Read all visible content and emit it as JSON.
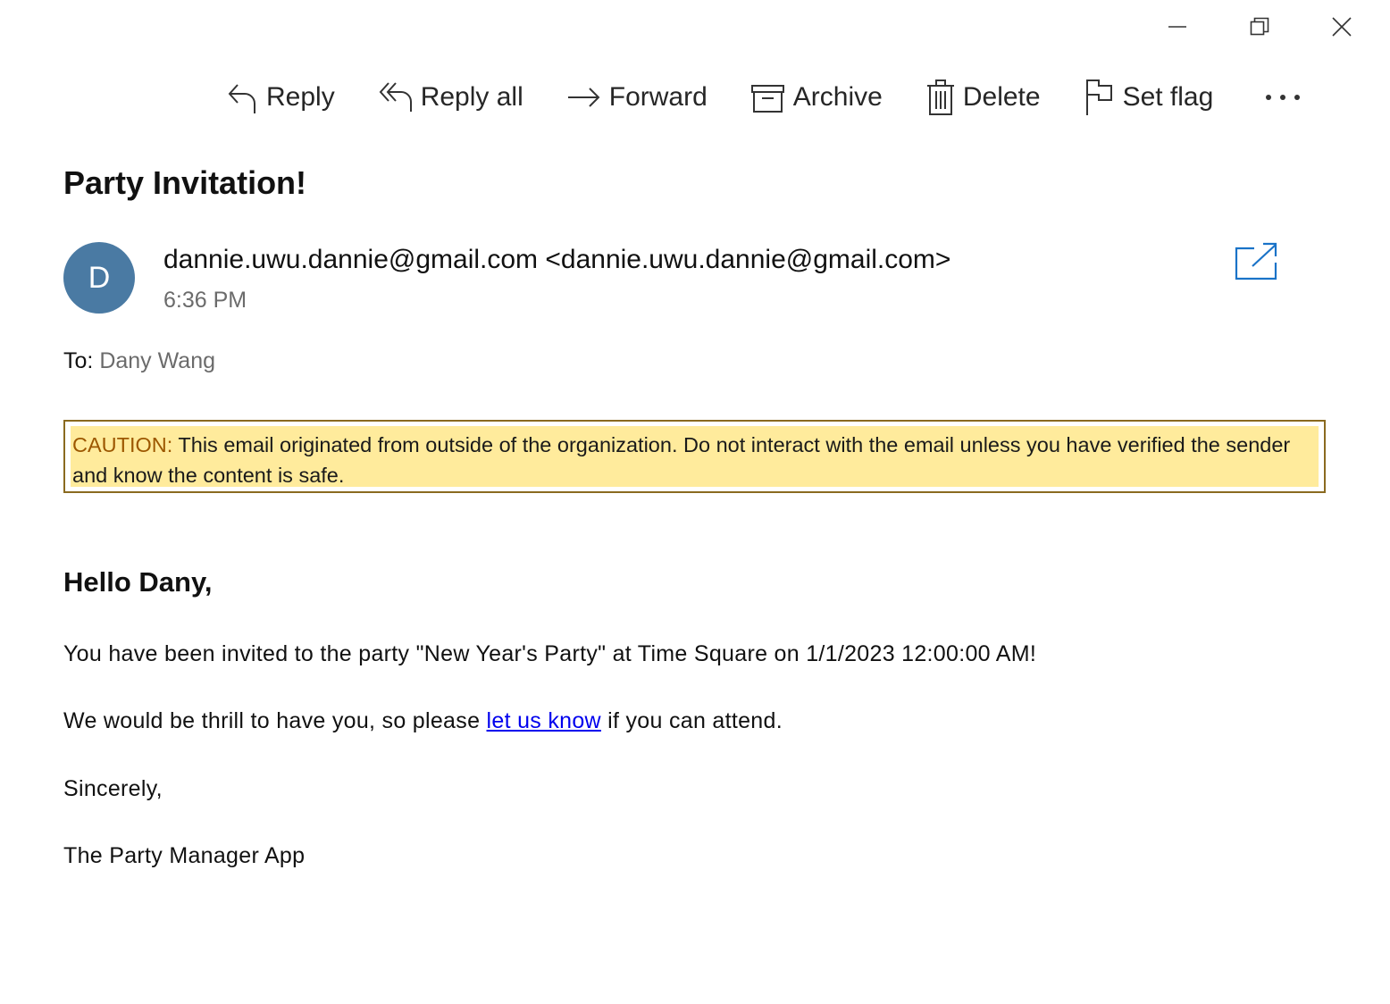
{
  "window_controls": {
    "minimize_icon": "minimize-icon",
    "restore_icon": "restore-icon",
    "close_icon": "close-icon"
  },
  "toolbar": {
    "reply_label": "Reply",
    "reply_all_label": "Reply all",
    "forward_label": "Forward",
    "archive_label": "Archive",
    "delete_label": "Delete",
    "set_flag_label": "Set flag",
    "more_label": "···"
  },
  "message": {
    "subject": "Party Invitation!",
    "avatar_initial": "D",
    "avatar_color": "#4a7aa3",
    "sender": "dannie.uwu.dannie@gmail.com <dannie.uwu.dannie@gmail.com>",
    "time": "6:36 PM",
    "to_label": "To:",
    "to_name": "Dany Wang"
  },
  "caution": {
    "label": "CAUTION:",
    "text": "This email originated from outside of the organization. Do not interact with the email unless you have verified the sender and know the content is safe.",
    "background": "#ffeb9c",
    "label_color": "#9c5700"
  },
  "body": {
    "greeting": "Hello Dany,",
    "line1": "You have been invited to the party \"New Year's Party\" at Time Square on 1/1/2023 12:00:00 AM!",
    "line2_before": "We would be thrill to have you, so please",
    "line2_link": "let us know",
    "line2_after": "if you can attend.",
    "closing": "Sincerely,",
    "signature": "The Party Manager App"
  },
  "colors": {
    "link": "#0000ee",
    "accent": "#1a73c8"
  }
}
